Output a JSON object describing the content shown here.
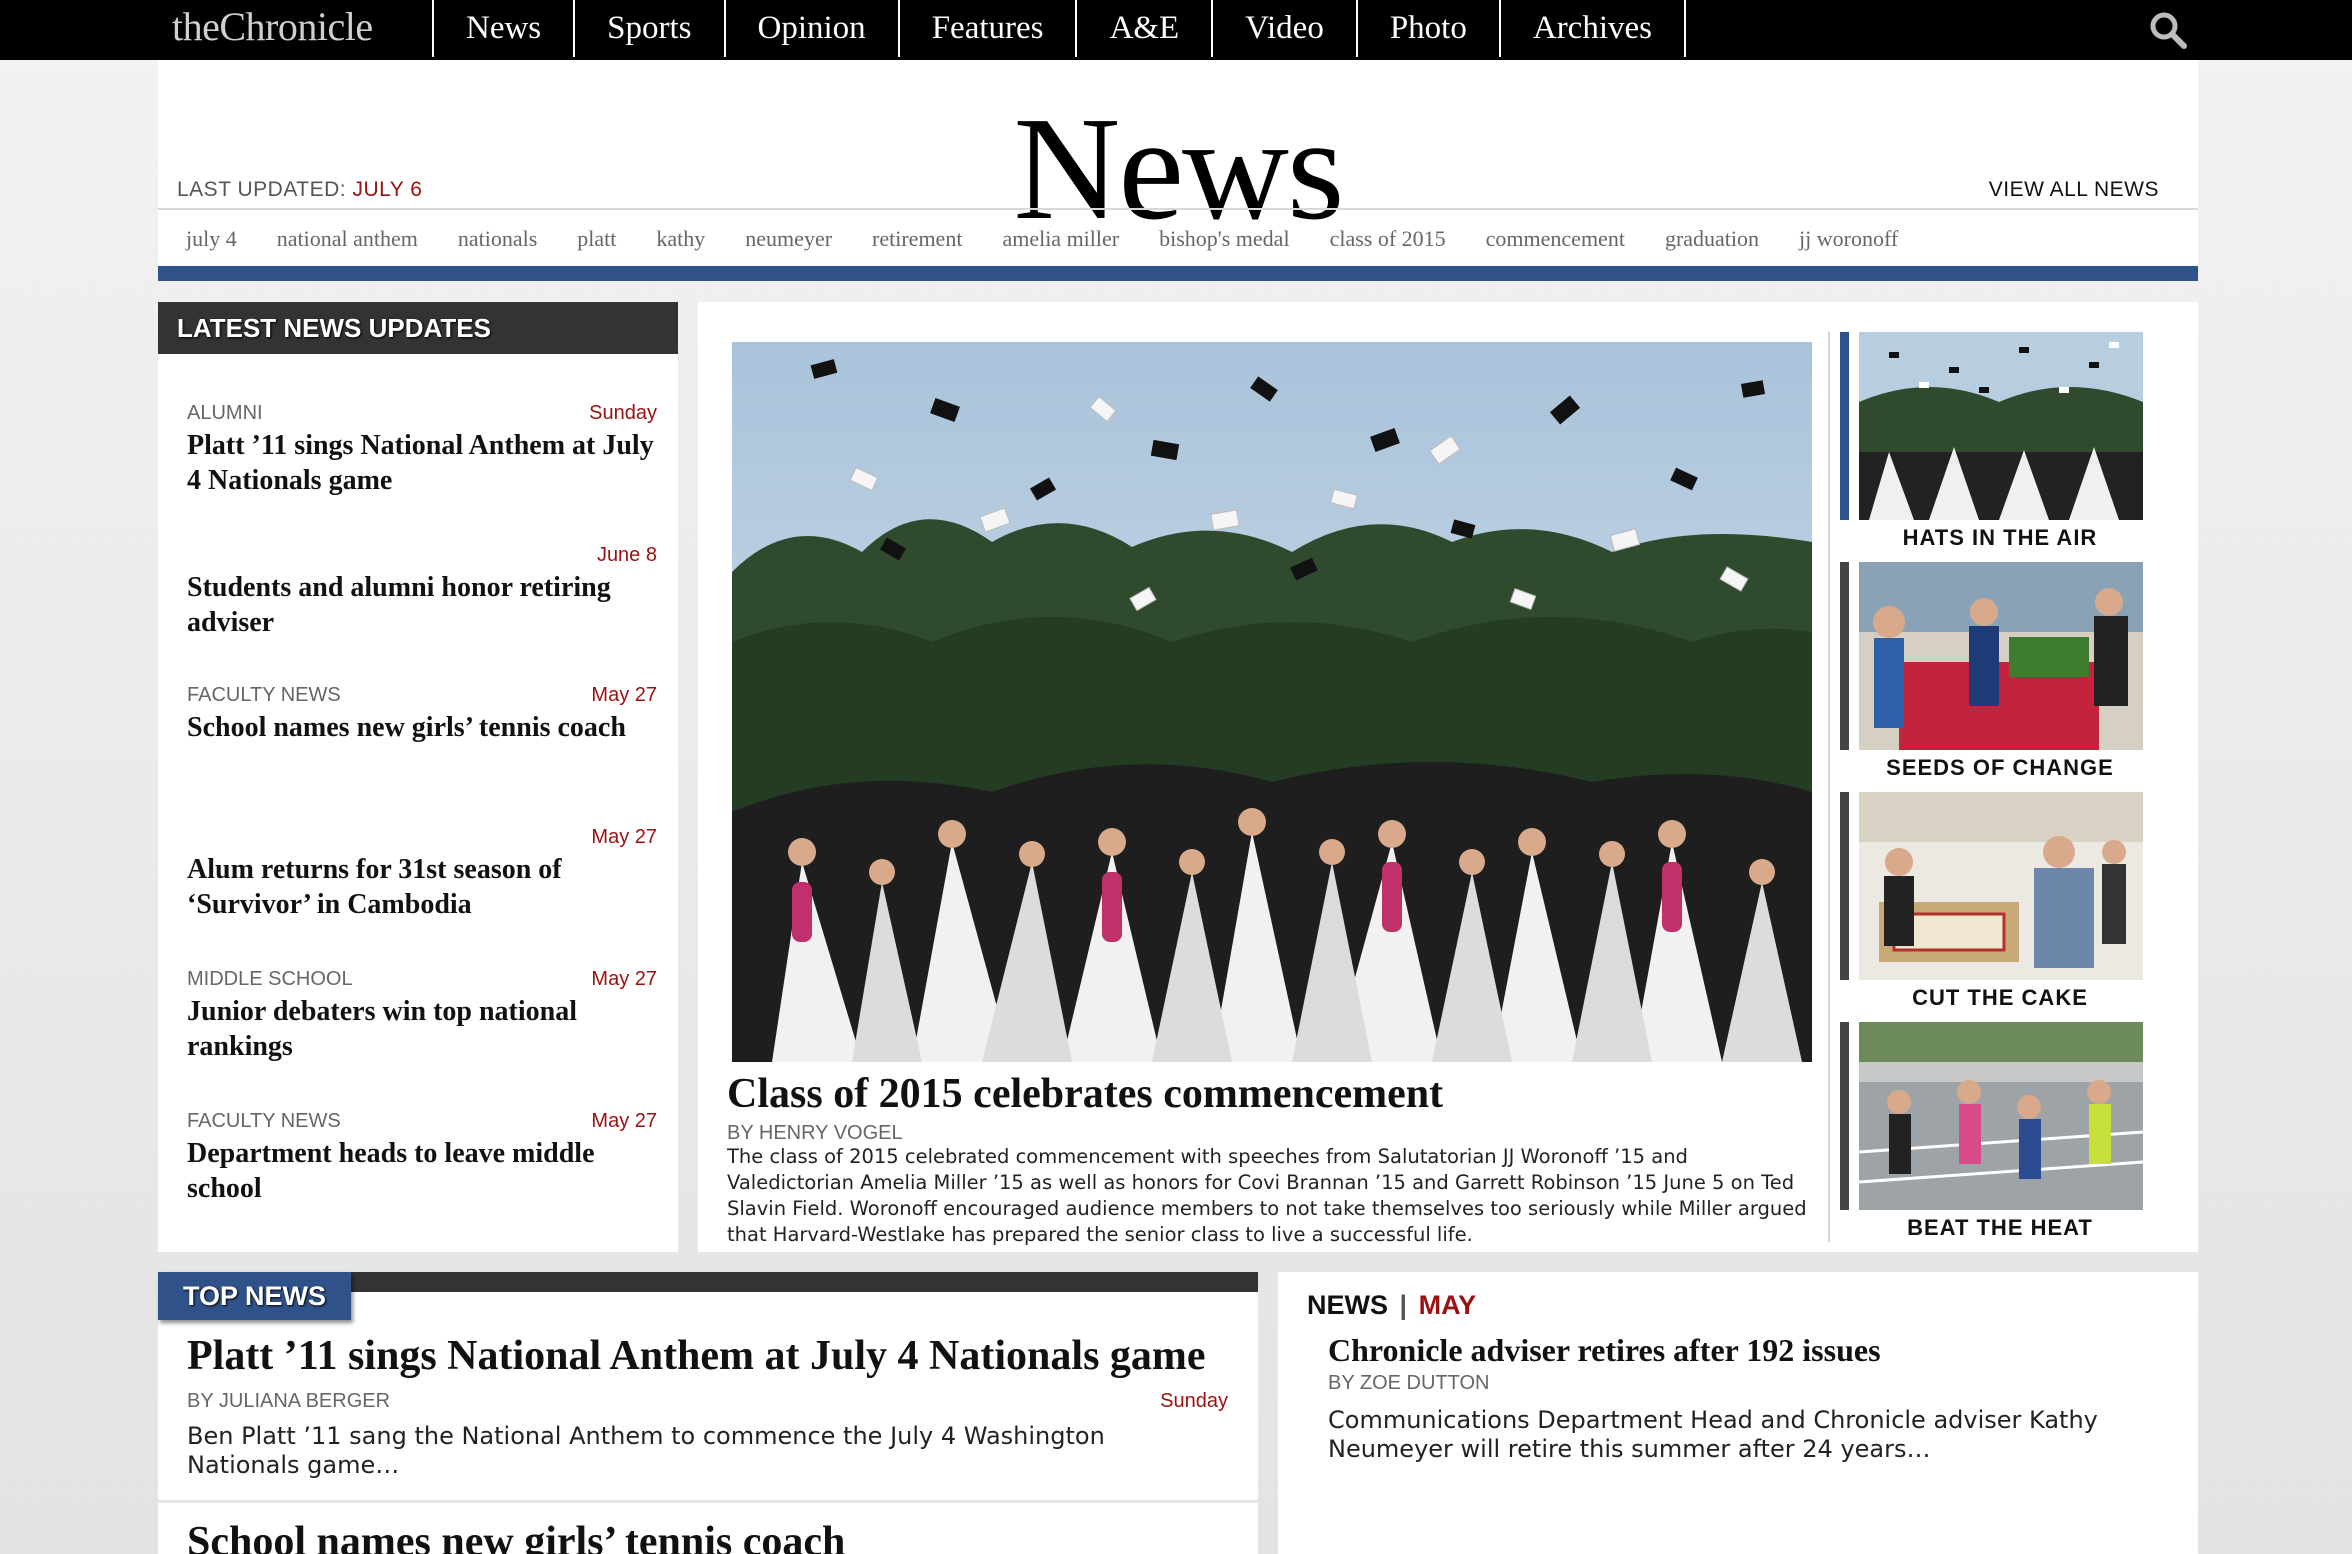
{
  "site": {
    "logo": "theChronicle"
  },
  "nav": {
    "items": [
      "News",
      "Sports",
      "Opinion",
      "Features",
      "A&E",
      "Video",
      "Photo",
      "Archives"
    ]
  },
  "header": {
    "title": "News",
    "last_updated_label": "LAST UPDATED:",
    "last_updated_date": "JULY 6",
    "view_all": "VIEW ALL NEWS"
  },
  "tags": [
    "july 4",
    "national anthem",
    "nationals",
    "platt",
    "kathy",
    "neumeyer",
    "retirement",
    "amelia miller",
    "bishop's medal",
    "class of 2015",
    "commencement",
    "graduation",
    "jj woronoff"
  ],
  "latest": {
    "heading": "LATEST NEWS UPDATES",
    "items": [
      {
        "category": "ALUMNI",
        "date": "Sunday",
        "title": "Platt ’11 sings National Anthem at July 4 Nationals game"
      },
      {
        "category": "",
        "date": "June 8",
        "title": "Students and alumni honor retiring adviser"
      },
      {
        "category": "FACULTY NEWS",
        "date": "May 27",
        "title": "School names new girls’ tennis coach"
      },
      {
        "category": "",
        "date": "May 27",
        "title": "Alum returns for 31st season of ‘Survivor’ in Cambodia"
      },
      {
        "category": "MIDDLE SCHOOL",
        "date": "May 27",
        "title": "Junior debaters win top national rankings"
      },
      {
        "category": "FACULTY NEWS",
        "date": "May 27",
        "title": "Department heads to leave middle school"
      }
    ]
  },
  "feature": {
    "title": "Class of 2015 celebrates commencement",
    "byline": "BY HENRY VOGEL",
    "description": "The class of 2015 celebrated commencement with speeches from Salutatorian JJ Woronoff ’15 and Valedictorian Amelia Miller ’15 as well as honors for Covi Brannan ’15 and Garrett Robinson ’15 June 5 on Ted Slavin Field. Woronoff encouraged audience members to not take themselves too seriously while Miller argued that Harvard-Westlake has prepared the senior class to live a successful life."
  },
  "thumbs": [
    {
      "caption": "HATS IN THE AIR"
    },
    {
      "caption": "SEEDS OF CHANGE"
    },
    {
      "caption": "CUT THE CAKE"
    },
    {
      "caption": "BEAT THE HEAT"
    }
  ],
  "top_news": {
    "tab": "TOP NEWS",
    "items": [
      {
        "title": "Platt ’11 sings National Anthem at July 4 Nationals game",
        "byline": "BY JULIANA BERGER",
        "date": "Sunday",
        "description": "Ben Platt ’11 sang the National Anthem to commence the July 4 Washington Nationals game…"
      },
      {
        "title": "School names new girls’ tennis coach"
      }
    ]
  },
  "news_may": {
    "label": "NEWS",
    "separator": "|",
    "month": "MAY",
    "title": "Chronicle adviser retires after 192 issues",
    "byline": "BY ZOE DUTTON",
    "description": "Communications Department Head and Chronicle adviser Kathy Neumeyer will retire this summer after 24 years…"
  },
  "colors": {
    "accent_blue": "#30528a",
    "date_red": "#9b1010",
    "nav_bg": "#000000"
  }
}
